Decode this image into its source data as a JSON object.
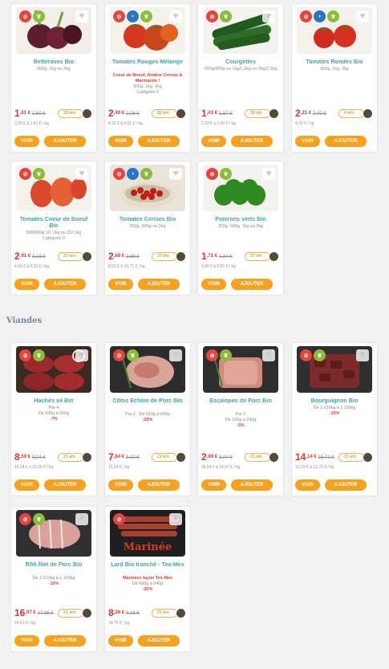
{
  "section_viandes": "Viandes",
  "buttons": {
    "voir": "VOIR",
    "add": "AJOUTER"
  },
  "products": [
    {
      "name": "Betteraves Bio",
      "sub1": "500g, 1kg ou 2kg",
      "sub2": "",
      "sub3": "",
      "price": "1",
      "cents": ",81 €",
      "old": "1,90 €",
      "dist": "28 km",
      "unit": "3,28 € à 1,62 € / kg",
      "badges": [
        "red",
        "green"
      ],
      "img": "beet"
    },
    {
      "name": "Tomates Rouges Mélange",
      "sub1": "Coeur de Boeuf, Andine Cornue & Marmande !",
      "sub2": "500g, 1kg, 2kg",
      "sub3": "Catégorie II",
      "price": "2",
      "cents": ",48 €",
      "old": "2,76 €",
      "dist": "50 km",
      "unit": "4,32 € à 4,51 € / kg",
      "badges": [
        "red",
        "blue",
        "green"
      ],
      "img": "tomato"
    },
    {
      "name": "Courgettes",
      "sub1": "500g/600g ou 1kg/1,1kg ou 2kg/2,1kg",
      "sub2": "",
      "sub3": "",
      "price": "1",
      "cents": ",41 €",
      "old": "1,57 €",
      "dist": "30 km",
      "unit": "2,19 € à 2,56 € / kg",
      "badges": [
        "red",
        "green"
      ],
      "img": "zucchini"
    },
    {
      "name": "Tomates Rondes Bio",
      "sub1": "500g, 1kg, 2kg",
      "sub2": "",
      "sub3": "",
      "price": "2",
      "cents": ",21 €",
      "old": "2,40 €",
      "dist": "6 km",
      "unit": "4,42 € / kg",
      "badges": [
        "red",
        "blue",
        "green"
      ],
      "img": "tomato2"
    },
    {
      "name": "Tomates Coeur de Boeuf Bio",
      "sub1": "500/600g 1/1.1kg ou 2/2.1kg",
      "sub2": "Catégorie II",
      "sub3": "",
      "price": "2",
      "cents": ",91 €",
      "old": "3,13 €",
      "dist": "37 km",
      "unit": "4,56 € à 5,10 € / kg",
      "badges": [
        "red",
        "green"
      ],
      "img": "coeur"
    },
    {
      "name": "Tomates Cerises Bio",
      "sub1": "250g, 500g ou 2kg",
      "sub2": "",
      "sub3": "",
      "price": "2",
      "cents": ",68 €",
      "old": "2,88 €",
      "dist": "37 km",
      "unit": "8,91 € à 10,72 € / kg",
      "badges": [
        "red",
        "blue",
        "green"
      ],
      "img": "cherry"
    },
    {
      "name": "Poivrons verts Bio",
      "sub1": "250g, 500g, 1kg ou 2kg",
      "sub2": "",
      "sub3": "",
      "price": "1",
      "cents": ",71 €",
      "old": "1,84 €",
      "dist": "37 km",
      "unit": "4,89 € à 6,81 € / kg",
      "badges": [
        "red",
        "green"
      ],
      "img": "pepper"
    },
    {
      "name": "Hachés x4 Bio",
      "sub1": "Par 4",
      "sub2": "De 530g à 550g",
      "sub3": "-7%",
      "price": "8",
      "cents": ",50 €",
      "old": "9,14 €",
      "dist": "21 km",
      "unit": "16,04 € à 16,05 € / kg",
      "badges": [
        "red",
        "green"
      ],
      "img": "mince"
    },
    {
      "name": "Côtes Echine de Porc Bio",
      "sub1": "Par 2 : De 610g à 640g",
      "sub2": "-25%",
      "sub3": "",
      "price": "7",
      "cents": ",84 €",
      "old": "9,22 €",
      "dist": "21 km",
      "unit": "12,24 € / kg",
      "badges": [
        "red",
        "green"
      ],
      "img": "pork"
    },
    {
      "name": "Escalopes de Porc Bio",
      "sub1": "Par 2",
      "sub2": "De 180g à 240g",
      "sub3": "-5%",
      "price": "2",
      "cents": ",89 €",
      "old": "3,04 €",
      "dist": "21 km",
      "unit": "16,04 € à 16,07 € / kg",
      "badges": [
        "red",
        "green"
      ],
      "img": "escalope"
    },
    {
      "name": "Bourguignon Bio",
      "sub1": "De 1.010kg à 1.100kg",
      "sub2": "-10%",
      "sub3": "",
      "price": "14",
      "cents": ",14 €",
      "old": "15,71 €",
      "dist": "21 km",
      "unit": "13,72 € à 12,72 € / kg",
      "badges": [
        "red",
        "green"
      ],
      "img": "bourg"
    },
    {
      "name": "Rôti filet de Porc Bio",
      "sub1": "De 1.010kg à 1.100kg",
      "sub2": "-10%",
      "sub3": "",
      "price": "16",
      "cents": ",07 €",
      "old": "17,85 €",
      "dist": "21 km",
      "unit": "14,61 € / kg",
      "badges": [
        "red",
        "green"
      ],
      "img": "roti"
    },
    {
      "name": "Lard Bio tranché - Tex-Mex",
      "sub1": "Marinées façon Tex-Mex",
      "sub2": "De 560g à 640g",
      "sub3": "-30%",
      "price": "8",
      "cents": ",26 €",
      "old": "9,18 €",
      "dist": "21 km",
      "unit": "14,75 € / kg",
      "badges": [
        "red"
      ],
      "img": "lard",
      "overlay": "Marinée"
    }
  ]
}
